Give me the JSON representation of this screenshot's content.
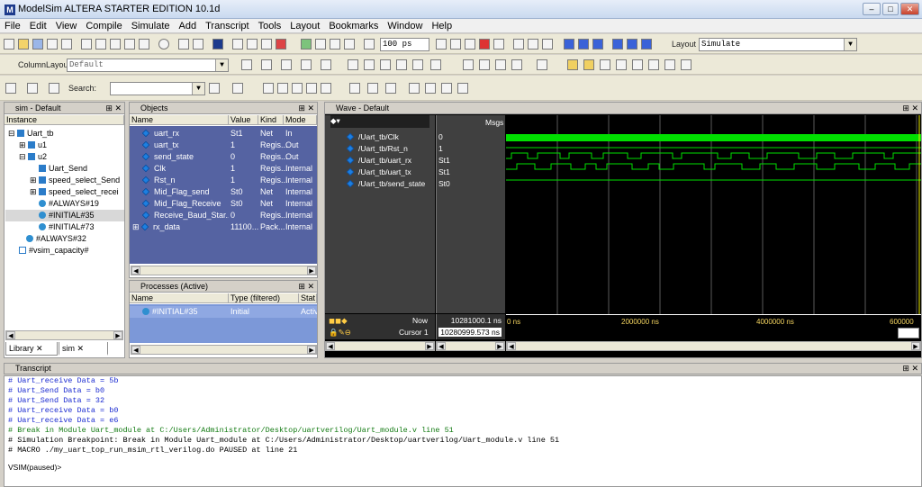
{
  "window": {
    "title": "ModelSim ALTERA STARTER EDITION 10.1d"
  },
  "menu": [
    "File",
    "Edit",
    "View",
    "Compile",
    "Simulate",
    "Add",
    "Transcript",
    "Tools",
    "Layout",
    "Bookmarks",
    "Window",
    "Help"
  ],
  "toolbar": {
    "run_length": "100 ps",
    "layout_label": "Layout",
    "layout_value": "Simulate",
    "column_layout_label": "ColumnLayout",
    "column_layout_value": "Default",
    "search_label": "Search:"
  },
  "sim_pane": {
    "title": "sim - Default",
    "column": "Instance",
    "items": [
      "Uart_tb",
      "u1",
      "u2",
      "Uart_Send",
      "speed_select_Send",
      "speed_select_recei",
      "#ALWAYS#19",
      "#INITIAL#35",
      "#INITIAL#73",
      "#ALWAYS#32",
      "#vsim_capacity#"
    ],
    "tabs": [
      "Library",
      "sim"
    ]
  },
  "objects_pane": {
    "title": "Objects",
    "columns": [
      "Name",
      "Value",
      "Kind",
      "Mode"
    ],
    "rows": [
      {
        "name": "uart_rx",
        "value": "St1",
        "kind": "Net",
        "mode": "In"
      },
      {
        "name": "uart_tx",
        "value": "1",
        "kind": "Regis...",
        "mode": "Out"
      },
      {
        "name": "send_state",
        "value": "0",
        "kind": "Regis...",
        "mode": "Out"
      },
      {
        "name": "Clk",
        "value": "1",
        "kind": "Regis...",
        "mode": "Internal"
      },
      {
        "name": "Rst_n",
        "value": "1",
        "kind": "Regis...",
        "mode": "Internal"
      },
      {
        "name": "Mid_Flag_send",
        "value": "St0",
        "kind": "Net",
        "mode": "Internal"
      },
      {
        "name": "Mid_Flag_Receive",
        "value": "St0",
        "kind": "Net",
        "mode": "Internal"
      },
      {
        "name": "Receive_Baud_Star...",
        "value": "0",
        "kind": "Regis...",
        "mode": "Internal"
      },
      {
        "name": "rx_data",
        "value": "11100...",
        "kind": "Pack...",
        "mode": "Internal"
      }
    ]
  },
  "processes_pane": {
    "title": "Processes (Active)",
    "columns": [
      "Name",
      "Type (filtered)",
      "Stat"
    ],
    "rows": [
      {
        "name": "#INITIAL#35",
        "type": "Initial",
        "state": "Activ"
      }
    ]
  },
  "wave_pane": {
    "title": "Wave - Default",
    "msgs_label": "Msgs",
    "signals": [
      {
        "name": "/Uart_tb/Clk",
        "value": "0"
      },
      {
        "name": "/Uart_tb/Rst_n",
        "value": "1"
      },
      {
        "name": "/Uart_tb/uart_rx",
        "value": "St1"
      },
      {
        "name": "/Uart_tb/uart_tx",
        "value": "St1"
      },
      {
        "name": "/Uart_tb/send_state",
        "value": "St0"
      }
    ],
    "now_label": "Now",
    "now_value": "10281000.1 ns",
    "cursor_label": "Cursor 1",
    "cursor_value": "10280999.573 ns",
    "time_ticks": [
      "0 ns",
      "2000000 ns",
      "4000000 ns",
      "600000"
    ]
  },
  "transcript": {
    "title": "Transcript",
    "lines": [
      {
        "text": "# Uart_receive Data = 5b",
        "color": "blue"
      },
      {
        "text": "# Uart_Send Data = b0",
        "color": "blue"
      },
      {
        "text": "# Uart_Send Data = 32",
        "color": "blue"
      },
      {
        "text": "# Uart_receive Data = b0",
        "color": "blue"
      },
      {
        "text": "# Uart_receive Data = e6",
        "color": "blue"
      },
      {
        "text": "# Break in Module Uart_module at C:/Users/Administrator/Desktop/uartverilog/Uart_module.v line 51",
        "color": "green"
      },
      {
        "text": "# Simulation Breakpoint: Break in Module Uart_module at C:/Users/Administrator/Desktop/uartverilog/Uart_module.v line 51",
        "color": "black"
      },
      {
        "text": "# MACRO ./my_uart_top_run_msim_rtl_verilog.do PAUSED at line 21",
        "color": "black"
      }
    ],
    "prompt": "VSIM(paused)>"
  }
}
